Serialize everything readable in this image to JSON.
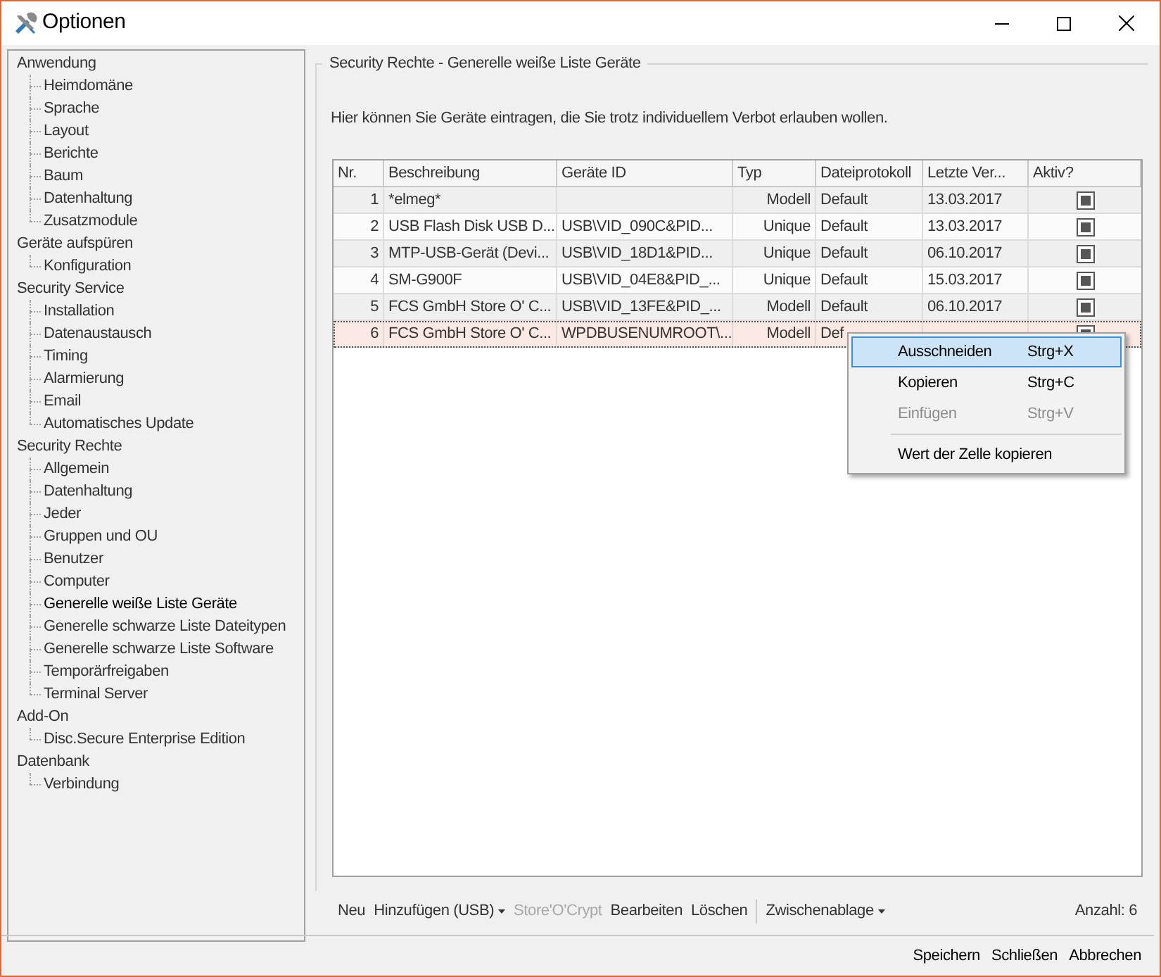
{
  "window": {
    "title": "Optionen"
  },
  "tree": [
    {
      "label": "Anwendung",
      "selected": false,
      "children": [
        {
          "label": "Heimdomäne",
          "selected": false
        },
        {
          "label": "Sprache",
          "selected": false
        },
        {
          "label": "Layout",
          "selected": false
        },
        {
          "label": "Berichte",
          "selected": false
        },
        {
          "label": "Baum",
          "selected": false
        },
        {
          "label": "Datenhaltung",
          "selected": false
        },
        {
          "label": "Zusatzmodule",
          "selected": false
        }
      ]
    },
    {
      "label": "Geräte aufspüren",
      "selected": false,
      "children": [
        {
          "label": "Konfiguration",
          "selected": false
        }
      ]
    },
    {
      "label": "Security Service",
      "selected": false,
      "children": [
        {
          "label": "Installation",
          "selected": false
        },
        {
          "label": "Datenaustausch",
          "selected": false
        },
        {
          "label": "Timing",
          "selected": false
        },
        {
          "label": "Alarmierung",
          "selected": false
        },
        {
          "label": "Email",
          "selected": false
        },
        {
          "label": "Automatisches Update",
          "selected": false
        }
      ]
    },
    {
      "label": "Security Rechte",
      "selected": false,
      "children": [
        {
          "label": "Allgemein",
          "selected": false
        },
        {
          "label": "Datenhaltung",
          "selected": false
        },
        {
          "label": "Jeder",
          "selected": false
        },
        {
          "label": "Gruppen und OU",
          "selected": false
        },
        {
          "label": "Benutzer",
          "selected": false
        },
        {
          "label": "Computer",
          "selected": false
        },
        {
          "label": "Generelle weiße Liste Geräte",
          "selected": true
        },
        {
          "label": "Generelle schwarze Liste Dateitypen",
          "selected": false
        },
        {
          "label": "Generelle schwarze Liste Software",
          "selected": false
        },
        {
          "label": "Temporärfreigaben",
          "selected": false
        },
        {
          "label": "Terminal Server",
          "selected": false
        }
      ]
    },
    {
      "label": "Add-On",
      "selected": false,
      "children": [
        {
          "label": "Disc.Secure Enterprise Edition",
          "selected": false
        }
      ]
    },
    {
      "label": "Datenbank",
      "selected": false,
      "children": [
        {
          "label": "Verbindung",
          "selected": false
        }
      ]
    }
  ],
  "group": {
    "title": "Security Rechte - Generelle weiße Liste Geräte",
    "description": "Hier können Sie Geräte eintragen, die Sie trotz individuellem Verbot erlauben wollen."
  },
  "table": {
    "columns": [
      "Nr.",
      "Beschreibung",
      "Geräte ID",
      "Typ",
      "Dateiprotokoll",
      "Letzte Ver...",
      "Aktiv?"
    ],
    "rows": [
      {
        "nr": "1",
        "beschreibung": "*elmeg*",
        "id": "",
        "typ": "Modell",
        "protokoll": "Default",
        "datum": "13.03.2017",
        "active": true,
        "selected": false
      },
      {
        "nr": "2",
        "beschreibung": "USB Flash Disk USB D...",
        "id": "USB\\VID_090C&PID...",
        "typ": "Unique",
        "protokoll": "Default",
        "datum": "13.03.2017",
        "active": true,
        "selected": false
      },
      {
        "nr": "3",
        "beschreibung": "MTP-USB-Gerät (Devi...",
        "id": "USB\\VID_18D1&PID...",
        "typ": "Unique",
        "protokoll": "Default",
        "datum": "06.10.2017",
        "active": true,
        "selected": false
      },
      {
        "nr": "4",
        "beschreibung": "SM-G900F",
        "id": "USB\\VID_04E8&PID_...",
        "typ": "Unique",
        "protokoll": "Default",
        "datum": "15.03.2017",
        "active": true,
        "selected": false
      },
      {
        "nr": "5",
        "beschreibung": "FCS GmbH Store O' C...",
        "id": "USB\\VID_13FE&PID_...",
        "typ": "Modell",
        "protokoll": "Default",
        "datum": "06.10.2017",
        "active": true,
        "selected": false
      },
      {
        "nr": "6",
        "beschreibung": "FCS GmbH Store O' C...",
        "id": "WPDBUSENUMROOT\\...",
        "typ": "Modell",
        "protokoll": "Def",
        "datum": "",
        "active": true,
        "selected": true
      }
    ]
  },
  "context_menu": [
    {
      "kind": "item",
      "label": "Ausschneiden",
      "shortcut": "Strg+X",
      "disabled": false,
      "selected": true
    },
    {
      "kind": "item",
      "label": "Kopieren",
      "shortcut": "Strg+C",
      "disabled": false,
      "selected": false
    },
    {
      "kind": "item",
      "label": "Einfügen",
      "shortcut": "Strg+V",
      "disabled": true,
      "selected": false
    },
    {
      "kind": "separator"
    },
    {
      "kind": "item",
      "label": "Wert der Zelle kopieren",
      "disabled": false,
      "selected": false
    }
  ],
  "toolbar": [
    {
      "kind": "button",
      "label": "Neu",
      "disabled": false,
      "dropdown": false
    },
    {
      "kind": "button",
      "label": "Hinzufügen (USB)",
      "disabled": false,
      "dropdown": true
    },
    {
      "kind": "button",
      "label": "Store'O'Crypt",
      "disabled": true,
      "dropdown": false
    },
    {
      "kind": "button",
      "label": "Bearbeiten",
      "disabled": false,
      "dropdown": false
    },
    {
      "kind": "button",
      "label": "Löschen",
      "disabled": false,
      "dropdown": false
    },
    {
      "kind": "separator"
    },
    {
      "kind": "button",
      "label": "Zwischenablage",
      "disabled": false,
      "dropdown": true
    }
  ],
  "count": "Anzahl: 6",
  "buttons": [
    "Speichern",
    "Schließen",
    "Abbrechen"
  ]
}
